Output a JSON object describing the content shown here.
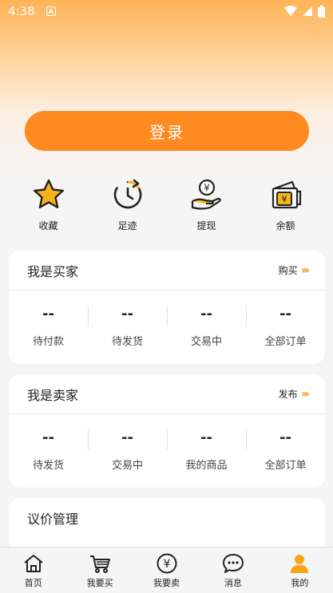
{
  "status_bar": {
    "time": "4:38",
    "notification_glyph": "A"
  },
  "login": {
    "label": "登录"
  },
  "quick_actions": [
    {
      "label": "收藏",
      "icon": "star-icon"
    },
    {
      "label": "足迹",
      "icon": "history-clock-icon"
    },
    {
      "label": "提现",
      "icon": "withdraw-hand-coin-icon"
    },
    {
      "label": "余额",
      "icon": "wallet-icon"
    }
  ],
  "buyer": {
    "title": "我是买家",
    "link_label": "购买",
    "stats": [
      {
        "value": "--",
        "label": "待付款"
      },
      {
        "value": "--",
        "label": "待发货"
      },
      {
        "value": "--",
        "label": "交易中"
      },
      {
        "value": "--",
        "label": "全部订单"
      }
    ]
  },
  "seller": {
    "title": "我是卖家",
    "link_label": "发布",
    "stats": [
      {
        "value": "--",
        "label": "待发货"
      },
      {
        "value": "--",
        "label": "交易中"
      },
      {
        "value": "--",
        "label": "我的商品"
      },
      {
        "value": "--",
        "label": "全部订单"
      }
    ]
  },
  "negotiation": {
    "title": "议价管理"
  },
  "tabbar": [
    {
      "label": "首页",
      "icon": "home-icon"
    },
    {
      "label": "我要买",
      "icon": "cart-icon"
    },
    {
      "label": "我要卖",
      "icon": "yen-coin-icon"
    },
    {
      "label": "消息",
      "icon": "chat-icon"
    },
    {
      "label": "我的",
      "icon": "profile-icon",
      "active": true
    }
  ],
  "colors": {
    "accent": "#ff8a1f",
    "icon_yellow": "#f6b21b",
    "chevron": "#f0a020"
  }
}
